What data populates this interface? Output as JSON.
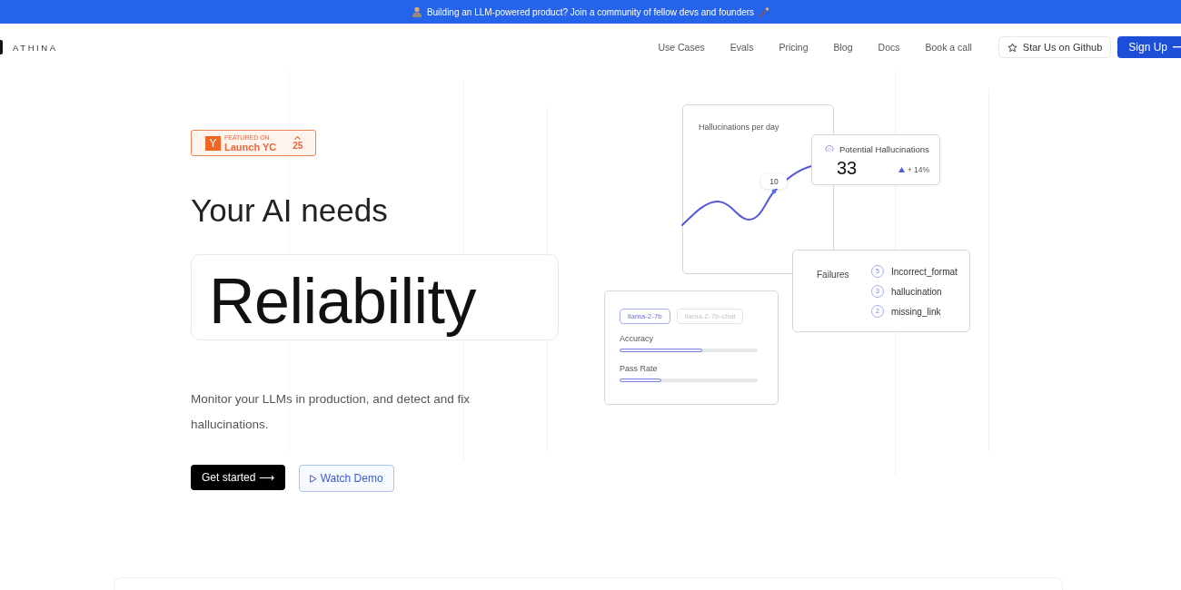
{
  "announcement": {
    "text": "Building an LLM-powered product? Join a community of fellow devs and founders"
  },
  "nav": {
    "logo": "ATHINA",
    "links": [
      {
        "label": "Use Cases"
      },
      {
        "label": "Evals"
      },
      {
        "label": "Pricing"
      },
      {
        "label": "Blog"
      },
      {
        "label": "Docs"
      },
      {
        "label": "Book a call"
      }
    ],
    "github_button": "Star Us on Github",
    "signup_button": "Sign Up"
  },
  "hero": {
    "badge": {
      "logo_letter": "Y",
      "kicker": "FEATURED ON",
      "label": "Launch YC",
      "upvotes": "25"
    },
    "headline": "Your AI needs",
    "highlight": "Reliability",
    "description": "Monitor your LLMs in production, and detect and fix hallucinations.",
    "buttons": [
      {
        "label": "Get started ⟶",
        "kind": "primary"
      },
      {
        "label": "Watch Demo",
        "kind": "secondary"
      }
    ]
  },
  "dashboard": {
    "trend_card": {
      "title": "Hallucinations per day",
      "point_label": "10"
    },
    "metric_card": {
      "title": "Potential Hallucinations",
      "value": "33",
      "change": "+ 14%"
    },
    "failures_card": {
      "title": "Failures",
      "items": [
        {
          "count": "5",
          "name": "Incorrect_format"
        },
        {
          "count": "3",
          "name": "hallucination"
        },
        {
          "count": "2",
          "name": "missing_link"
        }
      ]
    },
    "model_card": {
      "models": [
        {
          "label": "llama-2-7b",
          "selected": true
        },
        {
          "label": "llama-2-7b-chat",
          "selected": false
        }
      ],
      "meters": [
        {
          "label": "Accuracy",
          "level": 0.6
        },
        {
          "label": "Pass Rate",
          "level": 0.3
        }
      ]
    }
  }
}
